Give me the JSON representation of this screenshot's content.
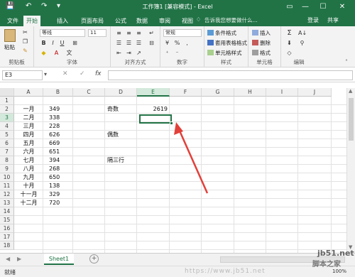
{
  "window": {
    "title": "工作簿1 [兼容模式] - Excel",
    "accent": "#217346",
    "controls": {
      "restore": "▭",
      "minimize": "—",
      "maximize": "☐",
      "close": "✕"
    }
  },
  "quick_access": {
    "save": "💾",
    "undo": "↶",
    "redo": "↷",
    "customize": "▾"
  },
  "tabs": [
    "文件",
    "开始",
    "插入",
    "页面布局",
    "公式",
    "数据",
    "审阅",
    "视图"
  ],
  "tell_me": "告诉我您想要做什么...",
  "account": {
    "login": "登录",
    "share": "共享"
  },
  "ribbon": {
    "clipboard": {
      "paste": "粘贴",
      "label": "剪贴板"
    },
    "font": {
      "name": "等线",
      "size": "11",
      "bold": "B",
      "italic": "I",
      "underline": "U",
      "label": "字体"
    },
    "alignment": {
      "label": "对齐方式"
    },
    "number": {
      "format": "常规",
      "percent": "%",
      "comma": ",",
      "label": "数字"
    },
    "styles": {
      "conditional": "条件格式",
      "table": "套用表格格式",
      "cell_styles": "单元格样式",
      "label": "样式"
    },
    "cells": {
      "insert": "插入",
      "delete": "删除",
      "format": "格式",
      "label": "单元格"
    },
    "editing": {
      "sum": "Σ",
      "sort": "A↓",
      "find": "⚲",
      "label": "编辑"
    }
  },
  "formula_bar": {
    "name_box": "E3",
    "fx": "fx",
    "value": ""
  },
  "columns": [
    "A",
    "B",
    "C",
    "D",
    "E",
    "F",
    "G",
    "H",
    "I",
    "J"
  ],
  "rows": [
    "1",
    "2",
    "3",
    "4",
    "5",
    "6",
    "7",
    "8",
    "9",
    "10",
    "11",
    "12",
    "13",
    "14",
    "15",
    "16",
    "17",
    "18"
  ],
  "selected": {
    "col": "E",
    "row": "3"
  },
  "cells": {
    "A": [
      "一月",
      "二月",
      "三月",
      "四月",
      "五月",
      "六月",
      "七月",
      "八月",
      "九月",
      "十月",
      "十一月",
      "十二月"
    ],
    "B": [
      "349",
      "338",
      "228",
      "626",
      "669",
      "651",
      "394",
      "268",
      "650",
      "138",
      "329",
      "720"
    ],
    "D2": "奇数",
    "E2": "2619",
    "D5": "偶数",
    "D8": "隔三行"
  },
  "sheet_tabs": [
    "Sheet1"
  ],
  "add_sheet": "+",
  "status": {
    "ready": "就绪",
    "zoom": "100%"
  },
  "watermark": {
    "url": "https://www.jb51.net",
    "site": "jb51.net",
    "site_sub": "脚本之家"
  }
}
